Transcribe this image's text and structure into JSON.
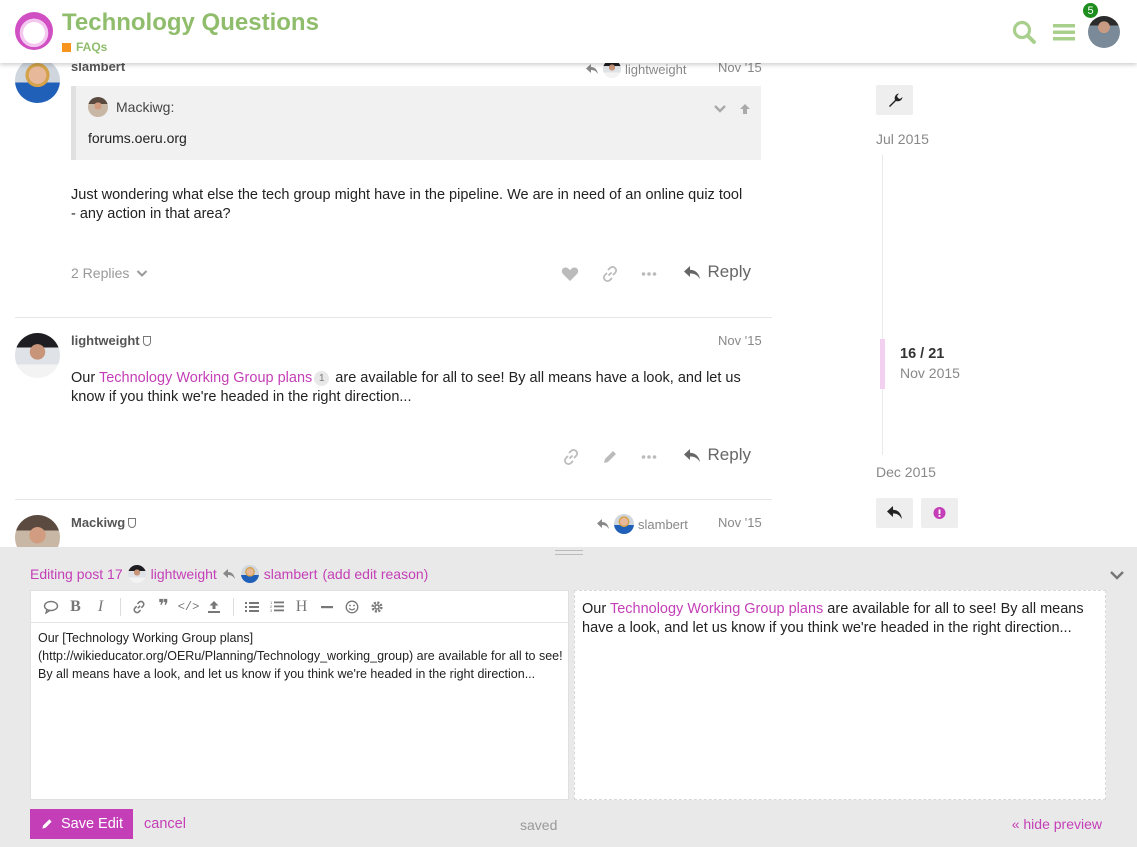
{
  "header": {
    "site_title": "Technology Questions",
    "category": "FAQs",
    "category_color": "#f7941d",
    "title_color": "#8fbd6c",
    "notification_count": "5"
  },
  "posts": [
    {
      "username": "slambert",
      "reply_to": "lightweight",
      "date": "Nov '15",
      "quote": {
        "author": "Mackiwg:",
        "body": "forums.oeru.org"
      },
      "text": "Just wondering what else the tech group might have in the pipeline. We are in need of an online quiz tool - any action in that area?",
      "replies_label": "2 Replies",
      "reply_label": "Reply"
    },
    {
      "username": "lightweight",
      "date": "Nov '15",
      "text_before": "Our ",
      "link_text": "Technology Working Group plans",
      "link_clicks": "1",
      "text_after": " are available for all to see! By all means have a look, and let us know if you think we're headed in the right direction...",
      "reply_label": "Reply"
    },
    {
      "username": "Mackiwg",
      "reply_to": "slambert",
      "date": "Nov '15"
    }
  ],
  "timeline": {
    "start_date": "Jul 2015",
    "position": "16 / 21",
    "position_date": "Nov 2015",
    "end_date": "Dec 2015"
  },
  "composer": {
    "heading_prefix": "Editing post 17",
    "heading_user": "lightweight",
    "heading_reply_user": "slambert",
    "edit_reason": "(add edit reason)",
    "raw_text": "Our [Technology Working Group plans](http://wikieducator.org/OERu/Planning/Technology_working_group) are available for all to see! By all means have a look, and let us know if you think we're headed in the right direction...",
    "preview_before": "Our ",
    "preview_link": "Technology Working Group plans",
    "preview_after": " are available for all to see! By all means have a look, and let us know if you think we're headed in the right direction...",
    "save_label": "Save Edit",
    "cancel_label": "cancel",
    "status": "saved",
    "hide_preview_label": "« hide preview"
  },
  "accent_color": "#c43fb7"
}
